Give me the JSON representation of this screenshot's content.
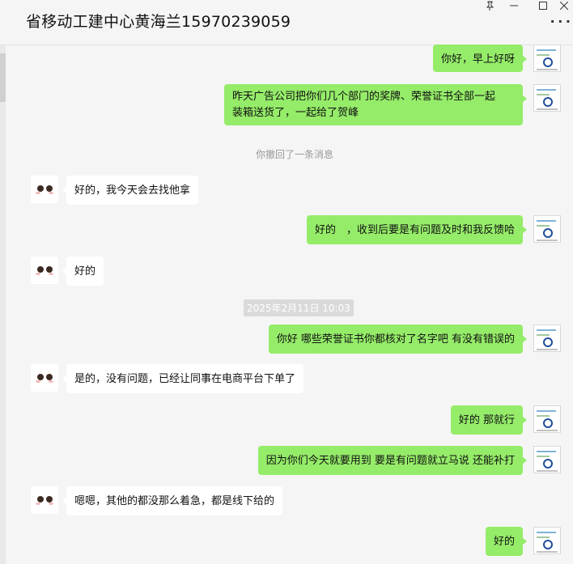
{
  "window": {
    "title": "省移动工建中心黄海兰15970239059"
  },
  "messages": [
    {
      "text": "你好，早上好呀"
    },
    {
      "line1": "昨天广告公司把你们几个部门的奖牌、荣誉证书全部一起",
      "line2": "装箱送货了，一起给了贺峰"
    },
    {
      "text": "你撤回了一条消息"
    },
    {
      "text": "好的，我今天会去找他拿"
    },
    {
      "text": "好的　，收到后要是有问题及时和我反馈哈"
    },
    {
      "text": "好的"
    },
    {
      "text": "2025年2月11日 10:03"
    },
    {
      "text": "你好  哪些荣誉证书你都核对了名字吧 有没有错误的"
    },
    {
      "text": "是的，没有问题，已经让同事在电商平台下单了"
    },
    {
      "text": "好的 那就行"
    },
    {
      "text": "因为你们今天就要用到  要是有问题就立马说 还能补打"
    },
    {
      "text": "嗯嗯，其他的都没那么着急，都是线下给的"
    },
    {
      "text": "好的"
    }
  ],
  "colors": {
    "me_bubble": "#95ec69",
    "other_bubble": "#ffffff",
    "background": "#f5f5f5"
  }
}
